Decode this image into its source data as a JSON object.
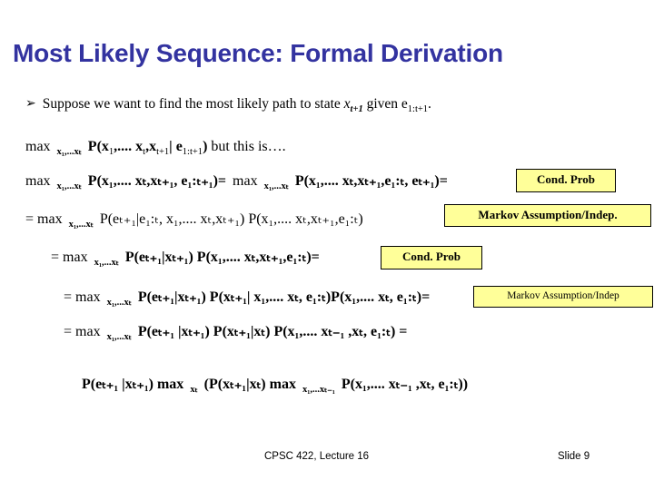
{
  "slide": {
    "title": "Most Likely Sequence: Formal Derivation",
    "title_color": "#3333A0",
    "background": "#ffffff"
  },
  "bullet": {
    "glyph": "➢",
    "glyph_name": "arrowhead-bullet",
    "text_a": "Suppose we want to find the most likely path to state ",
    "var_x": "x",
    "var_x_sub": "t+1",
    "text_b": " given ",
    "var_e": "e",
    "var_e_sub": "1:t+1",
    "text_c": "."
  },
  "equations": {
    "line1": {
      "max": "max",
      "max_sub": "x₁,...xₜ",
      "body_prefix": "P(x",
      "sub1": "1",
      "body_mid": ",.... x",
      "sub2": "t",
      "body_mid2": ",x",
      "sub3": "t+1",
      "body_bar": "| e",
      "sub4": "1:t+1",
      "body_suffix": ")",
      "tail": " but this is…."
    },
    "line2": {
      "lhs_max": "max",
      "lhs_max_sub": "x₁,...xₜ",
      "lhs": "P(x₁,.... xₜ,xₜ₊₁, e₁:ₜ₊₁)=",
      "rhs_max": "max",
      "rhs_max_sub": "x₁,...xₜ",
      "rhs": "P(x₁,.... xₜ,xₜ₊₁,e₁:ₜ, eₜ₊₁)="
    },
    "line3": {
      "lead": "= max",
      "max_sub": "x₁,...xₜ",
      "body": "P(eₜ₊₁|e₁:ₜ, x₁,.... xₜ,xₜ₊₁) P(x₁,.... xₜ,xₜ₊₁,e₁:ₜ)"
    },
    "line4": {
      "lead": "= max",
      "max_sub": "x₁,...xₜ",
      "body": "P(eₜ₊₁|xₜ₊₁) P(x₁,.... xₜ,xₜ₊₁,e₁:ₜ)="
    },
    "line5": {
      "lead": "= max",
      "max_sub": "x₁,...xₜ",
      "body": "P(eₜ₊₁|xₜ₊₁) P(xₜ₊₁| x₁,.... xₜ, e₁:ₜ)P(x₁,.... xₜ, e₁:ₜ)="
    },
    "line6": {
      "lead": "= max",
      "max_sub": "x₁,...xₜ",
      "body": "P(eₜ₊₁ |xₜ₊₁) P(xₜ₊₁|xₜ) P(x₁,.... xₜ₋₁ ,xₜ, e₁:ₜ) ="
    },
    "line7": {
      "body": "P(eₜ₊₁ |xₜ₊₁) max",
      "max_sub_1": "xₜ",
      "mid": "(P(xₜ₊₁|xₜ) max",
      "max_sub_2": "x₁,...xₜ₋₁",
      "tail": "P(x₁,.... xₜ₋₁ ,xₜ, e₁:ₜ))"
    }
  },
  "callouts": [
    {
      "label": "Cond. Prob",
      "name": "cond-prob-callout-1"
    },
    {
      "label": "Markov Assumption/Indep.",
      "name": "markov-callout-1"
    },
    {
      "label": "Cond. Prob",
      "name": "cond-prob-callout-2"
    },
    {
      "label": "Markov Assumption/Indep",
      "name": "markov-callout-2"
    }
  ],
  "callout_color": "#FFFF99",
  "footer": {
    "center": "CPSC 422, Lecture 16",
    "right": "Slide 9"
  }
}
